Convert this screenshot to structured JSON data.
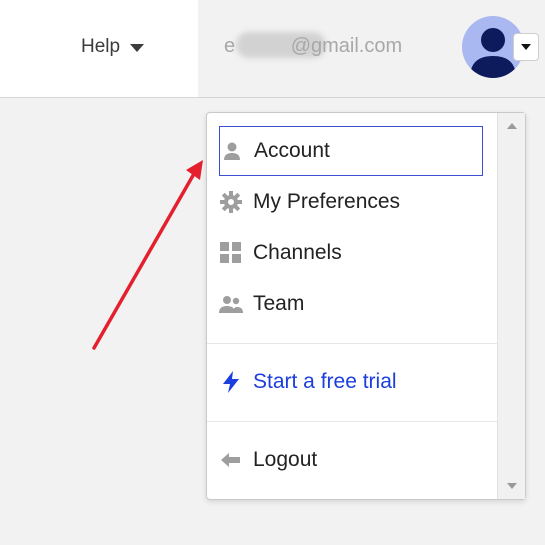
{
  "header": {
    "help_label": "Help",
    "email": "e          @gmail.com"
  },
  "menu": {
    "items": [
      {
        "label": "Account",
        "icon": "person-icon"
      },
      {
        "label": "My Preferences",
        "icon": "gear-icon"
      },
      {
        "label": "Channels",
        "icon": "grid-icon"
      },
      {
        "label": "Team",
        "icon": "people-icon"
      }
    ],
    "trial_label": "Start a free trial",
    "logout_label": "Logout"
  },
  "colors": {
    "accent": "#1b3ede",
    "focus_border": "#3b4fd6",
    "avatar_bg": "#a9b8f0",
    "avatar_fg": "#0d1b5c",
    "annotation_arrow": "#e4202e"
  }
}
